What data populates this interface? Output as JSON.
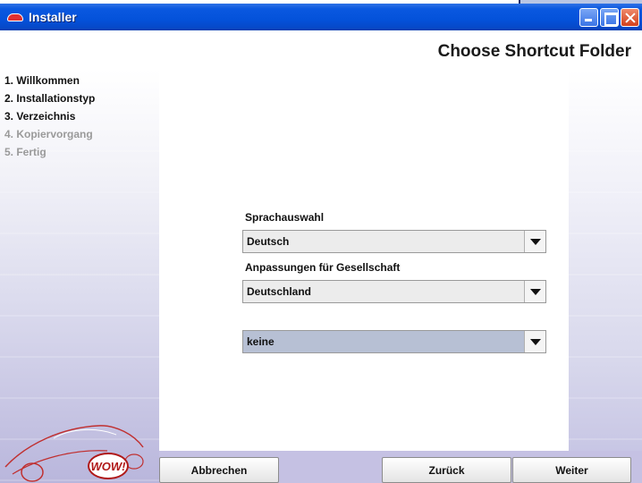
{
  "window": {
    "title": "Installer",
    "icon": "car-icon"
  },
  "header": {
    "page_title": "Choose Shortcut Folder"
  },
  "sidebar": {
    "steps": [
      {
        "label": "1. Willkommen",
        "state": "done"
      },
      {
        "label": "2. Installationstyp",
        "state": "done"
      },
      {
        "label": "3. Verzeichnis",
        "state": "current"
      },
      {
        "label": "4. Kopiervorgang",
        "state": "pending"
      },
      {
        "label": "5. Fertig",
        "state": "pending"
      }
    ],
    "logo_text": "WOW!"
  },
  "form": {
    "language_label": "Sprachauswahl",
    "language_value": "Deutsch",
    "company_label": "Anpassungen für Gesellschaft",
    "company_value": "Deutschland",
    "extra_value": "keine"
  },
  "buttons": {
    "cancel": "Abbrechen",
    "back": "Zurück",
    "next": "Weiter"
  },
  "colors": {
    "titlebar": "#0452da",
    "sidebar_accent": "#c5c1e3",
    "selected_combo": "#b7c0d4"
  }
}
